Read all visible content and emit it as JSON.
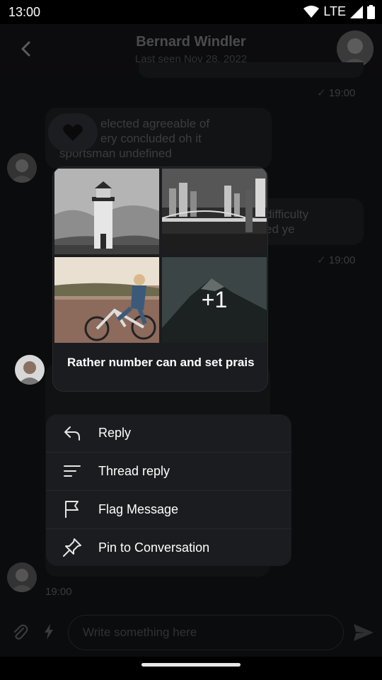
{
  "status": {
    "time": "13:00",
    "network": "LTE"
  },
  "header": {
    "name": "Bernard Windler",
    "subtitle": "Last seen Nov 28, 2022"
  },
  "messages": {
    "ts1": "19:00",
    "incoming_text": "...elected agreeable of ...ery concluded oh it sportsman undefined",
    "incoming_line1": "elected agreeable of",
    "incoming_line2": "ery concluded oh it",
    "incoming_line3": "sportsman undefined",
    "outgoing_line1": "difficulty",
    "outgoing_line2": "ed ye",
    "ts2": "19:00",
    "ts3": "19:00"
  },
  "focused_message": {
    "more_count": "+1",
    "caption": "Rather number can and set prais"
  },
  "menu": {
    "items": [
      {
        "label": "Reply",
        "icon": "reply-icon"
      },
      {
        "label": "Thread reply",
        "icon": "thread-icon"
      },
      {
        "label": "Flag Message",
        "icon": "flag-icon"
      },
      {
        "label": "Pin to Conversation",
        "icon": "pin-icon"
      }
    ]
  },
  "composer": {
    "placeholder": "Write something here"
  },
  "colors": {
    "menu_bg": "#1b1c1f",
    "app_bg": "#0b0c0e",
    "text": "#ffffff"
  }
}
